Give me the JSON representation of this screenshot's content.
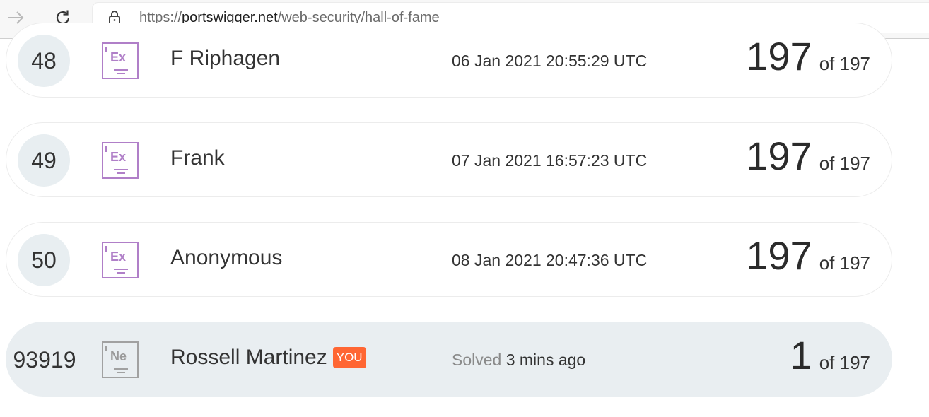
{
  "browser": {
    "url_scheme": "https://",
    "url_host": "portswigger.net",
    "url_path": "/web-security/hall-of-fame"
  },
  "leaderboard": {
    "rows": [
      {
        "rank": "48",
        "badge": "Ex",
        "name": "F Riphagen",
        "date": "06 Jan 2021 20:55:29 UTC",
        "score": "197",
        "of": "of 197"
      },
      {
        "rank": "49",
        "badge": "Ex",
        "name": "Frank",
        "date": "07 Jan 2021 16:57:23 UTC",
        "score": "197",
        "of": "of 197"
      },
      {
        "rank": "50",
        "badge": "Ex",
        "name": "Anonymous",
        "date": "08 Jan 2021 20:47:36 UTC",
        "score": "197",
        "of": "of 197"
      }
    ],
    "current_user": {
      "rank": "93919",
      "badge": "Ne",
      "name": "Rossell Martinez",
      "you_label": "YOU",
      "solved_label": "Solved",
      "solved_time": "3 mins ago",
      "score": "1",
      "of": "of 197"
    }
  },
  "colors": {
    "expert_badge": "#b07fc8",
    "novice_badge": "#a1a1a1",
    "you_tag": "#ff6633",
    "current_row_bg": "#e9eef1"
  }
}
